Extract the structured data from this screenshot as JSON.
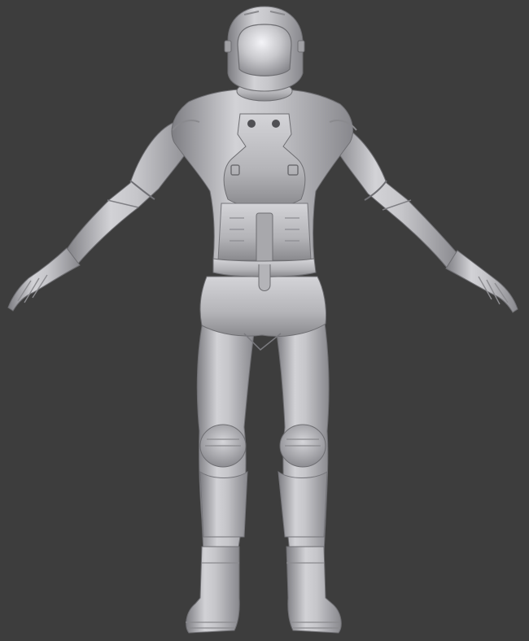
{
  "viewport": {
    "background_color": "#3d3d3d",
    "model_base_color": "#b9b9bd",
    "model_highlight_color": "#ececf0",
    "model_shadow_color": "#6e6e72"
  },
  "model": {
    "subject": "spacesuit-figure",
    "pose": "a-pose",
    "view": "front"
  }
}
